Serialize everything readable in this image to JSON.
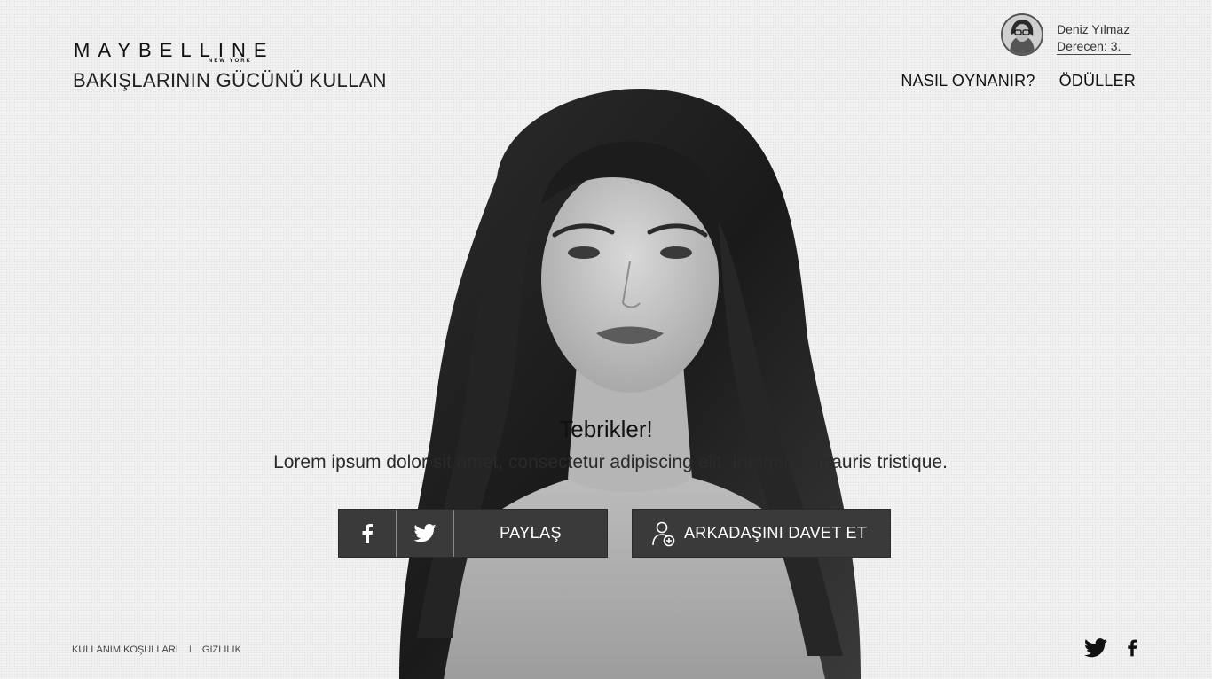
{
  "brand": {
    "logo_text": "MAYBELLINE",
    "logo_sub": "NEW YORK",
    "tagline": "BAKIŞLARININ GÜCÜNÜ KULLAN"
  },
  "user": {
    "name": "Deniz Yılmaz",
    "rank": "Derecen: 3.",
    "avatar_icon": "user-avatar"
  },
  "nav": {
    "how_to_play": "NASIL OYNANIR?",
    "rewards": "ÖDÜLLER"
  },
  "main": {
    "title": "Tebrikler!",
    "message": "Lorem ipsum dolor sit amet, consectetur adipiscing elit. Integer et mauris tristique."
  },
  "actions": {
    "share_label": "PAYLAŞ",
    "invite_label": "ARKADAŞINI DAVET ET",
    "facebook_icon": "facebook-icon",
    "twitter_icon": "twitter-icon",
    "add_user_icon": "add-user-icon"
  },
  "footer": {
    "terms": "KULLANIM KOŞULLARI",
    "separator": "I",
    "privacy": "GIZLILIK"
  },
  "colors": {
    "button_bg": "#3a3a3a",
    "text_dark": "#111111",
    "page_bg": "#f1f1f1"
  }
}
